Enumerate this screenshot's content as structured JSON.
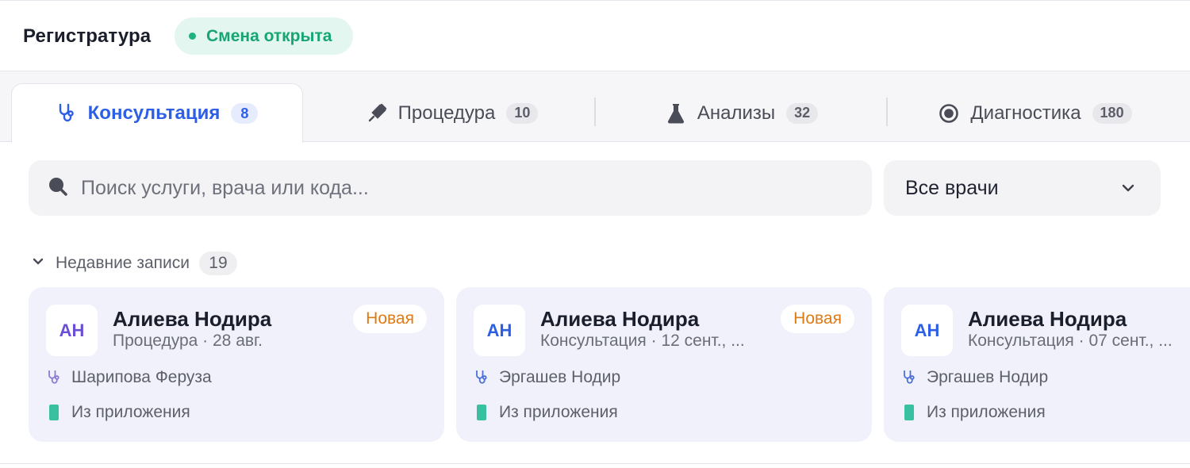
{
  "header": {
    "title": "Регистратура",
    "shift_status": "Смена открыта"
  },
  "tabs": [
    {
      "label": "Консультация",
      "count": "8",
      "icon": "stethoscope-icon",
      "active": true
    },
    {
      "label": "Процедура",
      "count": "10",
      "icon": "syringe-icon",
      "active": false
    },
    {
      "label": "Анализы",
      "count": "32",
      "icon": "flask-icon",
      "active": false
    },
    {
      "label": "Диагностика",
      "count": "180",
      "icon": "target-icon",
      "active": false
    }
  ],
  "search": {
    "placeholder": "Поиск услуги, врача или кода...",
    "value": ""
  },
  "doctor_filter": {
    "selected": "Все врачи"
  },
  "recent": {
    "label": "Недавние записи",
    "count": "19",
    "cards": [
      {
        "initials": "АН",
        "name": "Алиева Нодира",
        "subtitle": "Процедура · 28 авг.",
        "badge": "Новая",
        "doctor": "Шарипова Феруза",
        "source": "Из приложения"
      },
      {
        "initials": "АН",
        "name": "Алиева Нодира",
        "subtitle": "Консультация · 12 сент., ...",
        "badge": "Новая",
        "doctor": "Эргашев Нодир",
        "source": "Из приложения"
      },
      {
        "initials": "АН",
        "name": "Алиева Нодира",
        "subtitle": "Консультация · 07 сент., ...",
        "badge": "",
        "doctor": "Эргашев Нодир",
        "source": "Из приложения"
      }
    ]
  },
  "colors": {
    "accent": "#2d5fe6",
    "success": "#1fb27f",
    "badge_new": "#e07a12",
    "card_bg": "#f0f1fb"
  }
}
